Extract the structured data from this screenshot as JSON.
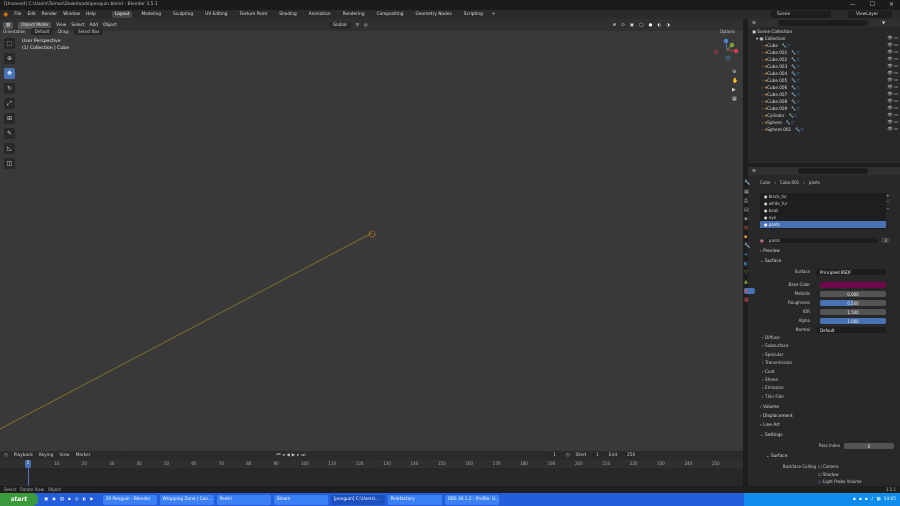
{
  "titlebar": {
    "title": "[Unsaved] C:\\Users\\Tomas\\Downloads\\penguin.blend - Blender 3.5.1",
    "min": "—",
    "max": "☐",
    "close": "✕"
  },
  "menubar": {
    "items": [
      "File",
      "Edit",
      "Render",
      "Window",
      "Help"
    ],
    "workspaces": [
      "Layout",
      "Modeling",
      "Sculpting",
      "UV Editing",
      "Texture Paint",
      "Shading",
      "Animation",
      "Rendering",
      "Compositing",
      "Geometry Nodes",
      "Scripting"
    ],
    "active_workspace": "Layout",
    "add_tab": "+",
    "scene": "Scene",
    "view_layer": "ViewLayer"
  },
  "viewport": {
    "mode": "Object Mode",
    "menus": [
      "View",
      "Select",
      "Add",
      "Object"
    ],
    "transform_orientation": "Global",
    "orientation_label": "Orientation",
    "pivot": "Default",
    "drag_label": "Drag:",
    "drag_value": "Select Box",
    "options": "Options",
    "info_line1": "User Perspective",
    "info_line2": "(1) Collection | Cube",
    "accent": "#4772b3"
  },
  "timeline": {
    "menus": [
      "Playback",
      "Keying",
      "View",
      "Marker"
    ],
    "current_frame": "1",
    "start_label": "Start",
    "start": "1",
    "end_label": "End",
    "end": "250",
    "ticks": [
      "0",
      "10",
      "20",
      "30",
      "40",
      "50",
      "60",
      "70",
      "80",
      "90",
      "100",
      "110",
      "120",
      "130",
      "140",
      "150",
      "160",
      "170",
      "180",
      "190",
      "200",
      "210",
      "220",
      "230",
      "240",
      "250"
    ]
  },
  "statusbar": {
    "select": "Select",
    "rotate": "Rotate View",
    "context": "Object",
    "version": "3.5.1"
  },
  "outliner": {
    "root": "Scene Collection",
    "collection": "Collection",
    "objects": [
      "Cube",
      "Cube.001",
      "Cube.002",
      "Cube.003",
      "Cube.004",
      "Cube.005",
      "Cube.006",
      "Cube.007",
      "Cube.008",
      "Cube.009",
      "Cylinder",
      "Sphere",
      "Sphere.001"
    ]
  },
  "properties": {
    "breadcrumb": [
      "Cube",
      "Cube.001",
      "pants"
    ],
    "slots": [
      "black_fur",
      "white_fur",
      "beak",
      "eye",
      "pants"
    ],
    "selected_slot": "pants",
    "material_name": "pants",
    "users": "3",
    "sections": {
      "preview": "Preview",
      "surface": "Surface",
      "surface_label": "Surface",
      "surface_value": "Principled BSDF",
      "base_color_label": "Base Color",
      "base_color": "#6e0a4c",
      "metallic_label": "Metallic",
      "metallic": "0.000",
      "roughness_label": "Roughness",
      "roughness": "0.500",
      "ior_label": "IOR",
      "ior": "1.500",
      "alpha_label": "Alpha",
      "alpha": "1.000",
      "normal_label": "Normal",
      "normal": "Default",
      "collapsed": [
        "Diffuse",
        "Subsurface",
        "Specular",
        "Transmission",
        "Coat",
        "Sheen",
        "Emission",
        "Thin Film"
      ],
      "volume": "Volume",
      "displacement": "Displacement",
      "line_art": "Line Art",
      "settings": "Settings",
      "pass_index_label": "Pass Index",
      "pass_index": "0",
      "surface_sub": "Surface",
      "backface_label": "Backface Culling",
      "camera": "Camera",
      "shadow": "Shadow",
      "light_probe": "Light Probe Volume"
    }
  },
  "taskbar": {
    "start": "start",
    "tasks": [
      "20 Penguin - Blender",
      "Wrapping Zone | Coo...",
      "Pentri",
      "Steam",
      "[penguin] C:\\Users\\...",
      "Pinkfactory",
      "OBS 30.1.2 - Profile: U..."
    ],
    "active_task": 4,
    "clock": "14:05"
  }
}
